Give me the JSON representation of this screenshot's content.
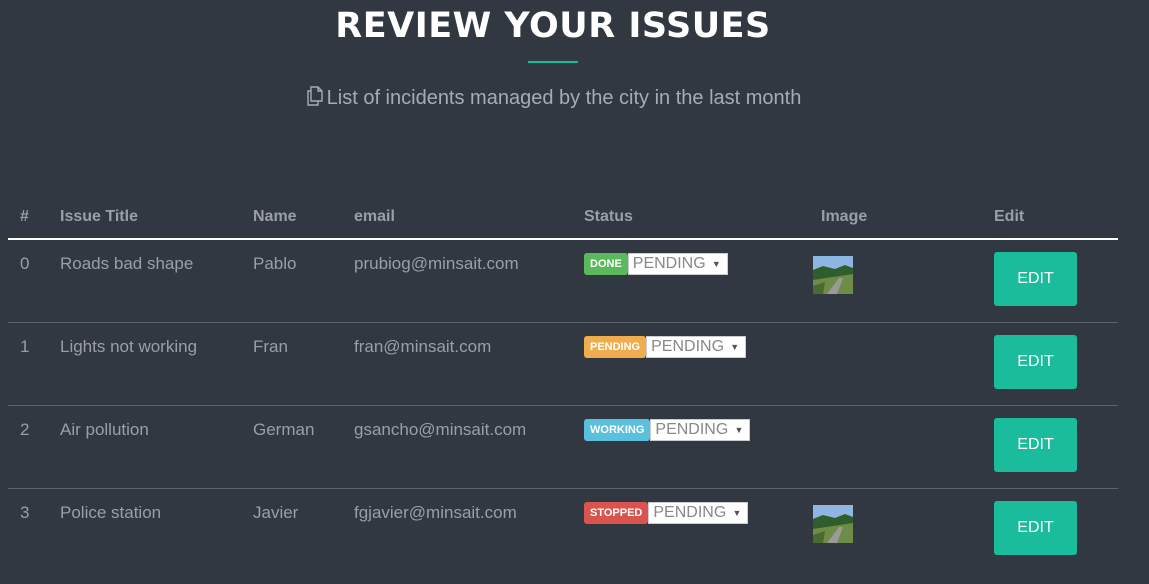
{
  "header": {
    "title": "REVIEW YOUR ISSUES",
    "subtitle": "List of incidents managed by the city in the last month",
    "subtitle_icon": "copy-icon",
    "accent_color": "#1abc9c"
  },
  "table": {
    "columns": [
      "#",
      "Issue Title",
      "Name",
      "email",
      "Status",
      "Image",
      "Edit"
    ],
    "rows": [
      {
        "id": "0",
        "title": "Roads bad shape",
        "name": "Pablo",
        "email": "prubiog@minsait.com",
        "badge": "DONE",
        "badge_color": "#5cb85c",
        "select": "PENDING",
        "has_image": true,
        "edit": "EDIT"
      },
      {
        "id": "1",
        "title": "Lights not working",
        "name": "Fran",
        "email": "fran@minsait.com",
        "badge": "PENDING",
        "badge_color": "#f0ad4e",
        "select": "PENDING",
        "has_image": false,
        "edit": "EDIT"
      },
      {
        "id": "2",
        "title": "Air pollution",
        "name": "German",
        "email": "gsancho@minsait.com",
        "badge": "WORKING",
        "badge_color": "#5bc0de",
        "select": "PENDING",
        "has_image": false,
        "edit": "EDIT"
      },
      {
        "id": "3",
        "title": "Police station",
        "name": "Javier",
        "email": "fgjavier@minsait.com",
        "badge": "STOPPED",
        "badge_color": "#d9534f",
        "select": "PENDING",
        "has_image": true,
        "edit": "EDIT"
      }
    ]
  }
}
